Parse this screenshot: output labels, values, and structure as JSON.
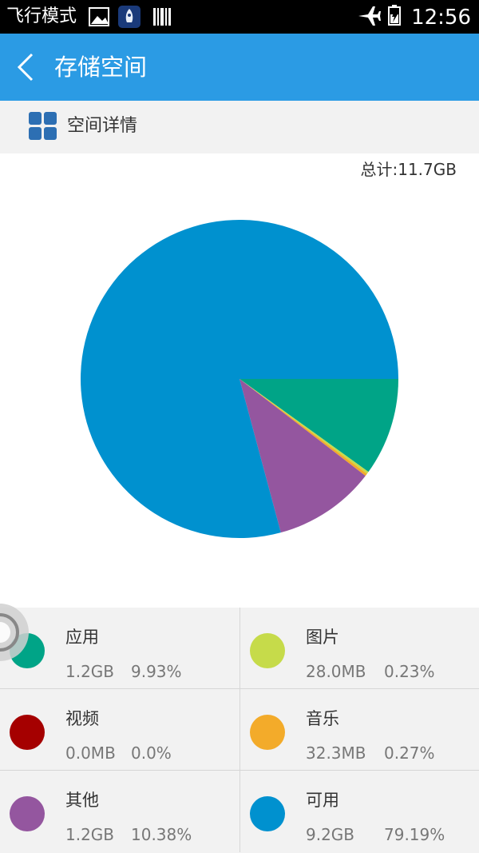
{
  "status_bar": {
    "airplane_mode_label": "飞行模式",
    "time": "12:56",
    "icons": [
      "image-icon",
      "rocket-app-icon",
      "barcode-icon",
      "airplane-icon",
      "battery-icon"
    ]
  },
  "app_bar": {
    "title": "存储空间",
    "back_icon": "back-arrow-icon"
  },
  "section": {
    "label": "空间详情",
    "icon": "grid-icon"
  },
  "total": "总计:11.7GB",
  "chart_data": {
    "type": "pie",
    "slices": [
      {
        "name": "应用",
        "value": 9.93,
        "color": "#00a487"
      },
      {
        "name": "图片",
        "value": 0.23,
        "color": "#c6db4a"
      },
      {
        "name": "视频",
        "value": 0.0,
        "color": "#a50000"
      },
      {
        "name": "音乐",
        "value": 0.27,
        "color": "#f3ab2a"
      },
      {
        "name": "其他",
        "value": 10.38,
        "color": "#94569f"
      },
      {
        "name": "可用",
        "value": 79.19,
        "color": "#0091cf"
      }
    ]
  },
  "legend": [
    {
      "name": "应用",
      "size": "1.2GB",
      "percent": "9.93%",
      "color": "#00a487"
    },
    {
      "name": "图片",
      "size": "28.0MB",
      "percent": "0.23%",
      "color": "#c6db4a"
    },
    {
      "name": "视频",
      "size": "0.0MB",
      "percent": "0.0%",
      "color": "#a50000"
    },
    {
      "name": "音乐",
      "size": "32.3MB",
      "percent": "0.27%",
      "color": "#f3ab2a"
    },
    {
      "name": "其他",
      "size": "1.2GB",
      "percent": "10.38%",
      "color": "#94569f"
    },
    {
      "name": "可用",
      "size": "9.2GB",
      "percent": "79.19%",
      "color": "#0091cf"
    }
  ]
}
